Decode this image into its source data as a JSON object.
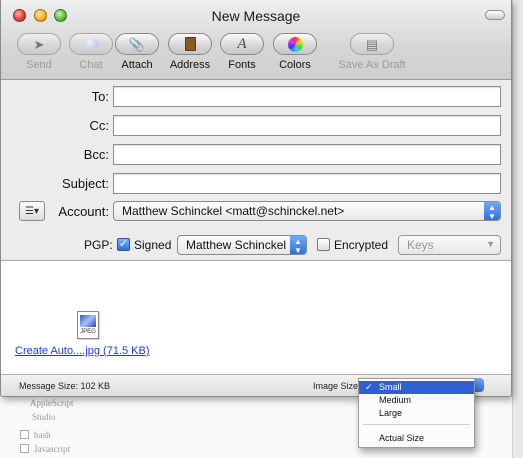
{
  "window": {
    "title": "New Message"
  },
  "toolbar": [
    {
      "label": "Send",
      "icon": "send-icon",
      "enabled": false
    },
    {
      "label": "Chat",
      "icon": "chat-icon",
      "enabled": false
    },
    {
      "label": "Attach",
      "icon": "paperclip-icon",
      "enabled": true
    },
    {
      "label": "Address",
      "icon": "address-book-icon",
      "enabled": true
    },
    {
      "label": "Fonts",
      "icon": "fonts-icon",
      "enabled": true
    },
    {
      "label": "Colors",
      "icon": "color-wheel-icon",
      "enabled": true
    },
    {
      "label": "Save As Draft",
      "icon": "save-draft-icon",
      "enabled": false
    }
  ],
  "fields": {
    "to": {
      "label": "To:",
      "value": ""
    },
    "cc": {
      "label": "Cc:",
      "value": ""
    },
    "bcc": {
      "label": "Bcc:",
      "value": ""
    },
    "subject": {
      "label": "Subject:",
      "value": ""
    },
    "account": {
      "label": "Account:",
      "value": "Matthew Schinckel <matt@schinckel.net>"
    }
  },
  "pgp": {
    "label": "PGP:",
    "signed": {
      "label": "Signed",
      "checked": true
    },
    "signer": "Matthew Schinckel",
    "encrypted": {
      "label": "Encrypted",
      "checked": false
    },
    "keys": "Keys"
  },
  "attachment": {
    "icon_label": "JPEG",
    "link": "Create Auto....jpg (71.5 KB)"
  },
  "status": {
    "message_size": "Message Size: 102 KB",
    "image_size_label": "Image Size:"
  },
  "image_size_menu": {
    "items": [
      "Small",
      "Medium",
      "Large",
      "Actual Size"
    ],
    "selected": "Small",
    "check": "✓"
  },
  "background": {
    "texts": [
      "AppleScript",
      "Studio",
      "bash",
      "Javascript"
    ]
  },
  "colors": {
    "accent": "#2f6fe0",
    "link": "#1a3fd6",
    "selection": "#2f5fd0"
  }
}
